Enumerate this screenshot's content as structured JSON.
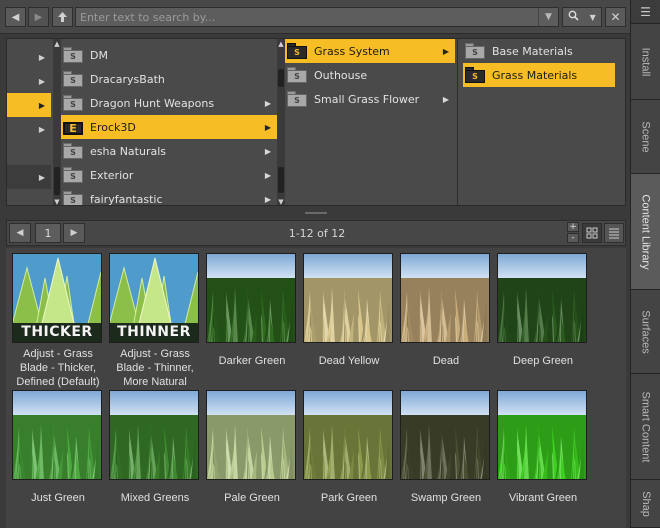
{
  "toolbar": {
    "back_icon": "back-arrow-icon",
    "forward_icon": "forward-arrow-icon",
    "up_icon": "up-arrow-icon",
    "search_placeholder": "Enter text to search by...",
    "search_value": ""
  },
  "tabs": [
    "Install",
    "Scene",
    "Content Library",
    "Surfaces",
    "Smart Content",
    "Shap"
  ],
  "active_tab": "Content Library",
  "nav": {
    "column1": {
      "items": [
        {
          "label": "DM",
          "selected": false
        },
        {
          "label": "DracarysBath",
          "selected": false
        },
        {
          "label": "Dragon Hunt Weapons",
          "selected": false
        },
        {
          "label": "Erock3D",
          "selected": true,
          "icon_letter": "E"
        },
        {
          "label": "esha Naturals",
          "selected": false
        },
        {
          "label": "Exterior",
          "selected": false
        },
        {
          "label": "fairyfantastic",
          "selected": false
        }
      ]
    },
    "column2": {
      "items": [
        {
          "label": "Grass System",
          "selected": true
        },
        {
          "label": "Outhouse",
          "selected": false
        },
        {
          "label": "Small Grass Flower",
          "selected": false
        }
      ]
    },
    "column3": {
      "items": [
        {
          "label": "Base Materials",
          "selected": false
        },
        {
          "label": "Grass Materials",
          "selected": true
        }
      ]
    },
    "folder_badge": "S"
  },
  "pager": {
    "page": "1",
    "info": "1-12 of 12"
  },
  "thumbnails": [
    {
      "caption": "Adjust - Grass Blade - Thicker, Defined (Default)",
      "overlay": "THICKER",
      "style": "blade"
    },
    {
      "caption": "Adjust - Grass Blade - Thinner, More Natural",
      "overlay": "THINNER",
      "style": "blade"
    },
    {
      "caption": "Darker Green",
      "style": "grass",
      "color": "#2e6a1e"
    },
    {
      "caption": "Dead Yellow",
      "style": "grass",
      "color": "#d8c68a"
    },
    {
      "caption": "Dead",
      "style": "grass",
      "color": "#c8ac7a"
    },
    {
      "caption": "Deep Green",
      "style": "grass",
      "color": "#2a5a1e"
    },
    {
      "caption": "Just Green",
      "style": "grass",
      "color": "#4aa83c"
    },
    {
      "caption": "Mixed Greens",
      "style": "grass",
      "color": "#3e8a2e"
    },
    {
      "caption": "Pale Green",
      "style": "grass",
      "color": "#b8cc8c"
    },
    {
      "caption": "Park Green",
      "style": "grass",
      "color": "#8a9a4a"
    },
    {
      "caption": "Swamp Green",
      "style": "grass",
      "color": "#4a4e32"
    },
    {
      "caption": "Vibrant Green",
      "style": "grass",
      "color": "#3cd01e"
    }
  ],
  "colors": {
    "selection": "#f6bd24",
    "panel": "#4a4a4a",
    "background": "#3a3a3a"
  }
}
